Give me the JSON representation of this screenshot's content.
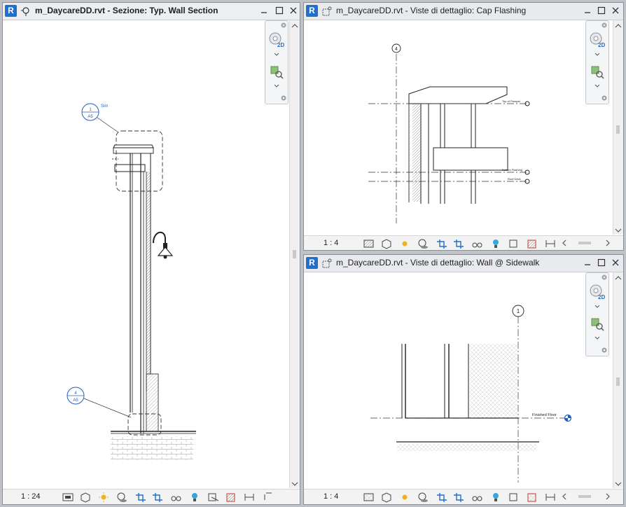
{
  "windows": {
    "left": {
      "title": "m_DaycareDD.rvt - Sezione: Typ. Wall Section",
      "scale": "1 : 24",
      "callout_top": {
        "number": "1",
        "sheet": "A5",
        "label": "Sim"
      },
      "callout_bottom": {
        "number": "4",
        "sheet": "A5"
      }
    },
    "top_right": {
      "title": "m_DaycareDD.rvt - Viste di dettaglio: Cap Flashing",
      "scale": "1 : 4",
      "grid_label": "4",
      "levels": [
        "Top of Parapet",
        "Bottom Flashing",
        "Roof Deck"
      ]
    },
    "bottom_right": {
      "title": "m_DaycareDD.rvt - Viste di dettaglio: Wall @ Sidewalk",
      "scale": "1 : 4",
      "grid_label": "1",
      "level": "Finished Floor"
    }
  },
  "app_logo_letter": "R",
  "colors": {
    "accent": "#1f6fd1",
    "annotation_blue": "#1f5fbf",
    "frame": "#bfc3c8"
  }
}
